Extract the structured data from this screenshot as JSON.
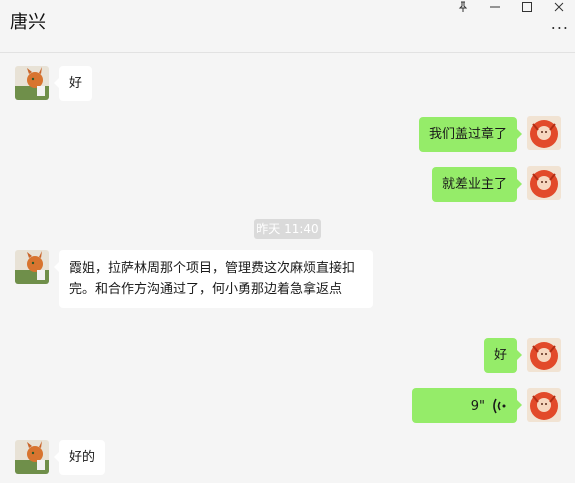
{
  "header": {
    "title": "唐兴",
    "more_label": "..."
  },
  "timestamp": "昨天 11:40",
  "messages": [
    {
      "from": "in",
      "text": "好"
    },
    {
      "from": "out",
      "text": "我们盖过章了"
    },
    {
      "from": "out",
      "text": "就差业主了"
    },
    {
      "from": "in",
      "text": "霞姐，拉萨林周那个项目，管理费这次麻烦直接扣完。和合作方沟通过了，何小勇那边着急拿返点"
    },
    {
      "from": "out",
      "text": "好"
    },
    {
      "from": "out",
      "type": "voice",
      "duration": "9\""
    },
    {
      "from": "in",
      "text": "好的"
    }
  ],
  "colors": {
    "incoming_bubble": "#ffffff",
    "outgoing_bubble": "#95ec69",
    "background": "#f5f5f5"
  },
  "icons": [
    "pin-icon",
    "minimize-icon",
    "maximize-icon",
    "more-icon",
    "voice-wave-icon"
  ]
}
